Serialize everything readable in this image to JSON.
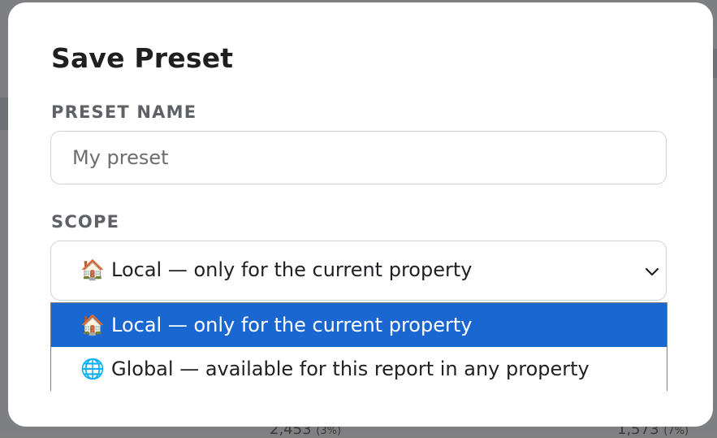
{
  "dialog": {
    "title": "Save Preset"
  },
  "preset_name": {
    "label": "PRESET NAME",
    "placeholder": "My preset",
    "value": ""
  },
  "scope": {
    "label": "SCOPE",
    "selected_icon": "🏠",
    "selected_label": "Local — only for the current property",
    "options": [
      {
        "icon": "🏠",
        "label": "Local — only for the current property",
        "highlighted": true
      },
      {
        "icon": "🌐",
        "label": "Global — available for this report in any property",
        "highlighted": false
      }
    ]
  },
  "background": {
    "fragment_1": "2,453",
    "fragment_1_pct": "(3%)",
    "fragment_2": "1,573",
    "fragment_2_pct": "(7%)"
  },
  "colors": {
    "highlight": "#1a67d2",
    "backdrop": "#7d7f82"
  }
}
